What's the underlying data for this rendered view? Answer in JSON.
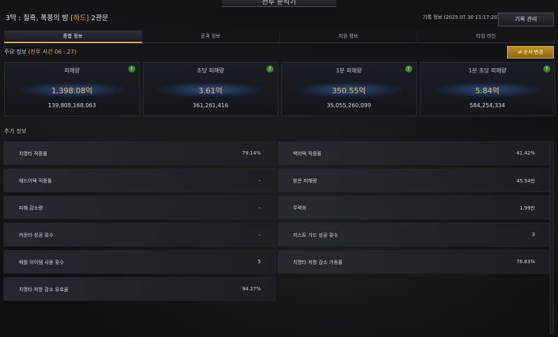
{
  "window": {
    "title": "전투 분석기"
  },
  "header": {
    "title_prefix": "3막 : 칠흑, 폭풍의 밤 ",
    "difficulty": "[하드]",
    "gate": " 2관문",
    "record_info": "기록 정보 (2025.07.30 11:17:20)",
    "record_button": "기록 관리"
  },
  "tabs": [
    "종합 정보",
    "공격 정보",
    "지원 정보",
    "타임 라인"
  ],
  "main_section": {
    "label": "주요 정보 ",
    "battle_time": "(전투 시간 06 : 27)",
    "order_button": "순서 변경"
  },
  "cards": [
    {
      "name": "피해량",
      "value": "1,398.08억",
      "sub": "139,808,168,063"
    },
    {
      "name": "초당 피해량",
      "value": "3.61억",
      "sub": "361,261,416"
    },
    {
      "name": "1분 피해량",
      "value": "350.55억",
      "sub": "35,055,260,099"
    },
    {
      "name": "1분 초당 피해량",
      "value": "5.84억",
      "sub": "584,254,334"
    }
  ],
  "help_icon": "?",
  "extra_section": {
    "label": "추가 정보"
  },
  "left_stats": [
    {
      "label": "치명타 적중률",
      "value": "79.14%"
    },
    {
      "label": "헤드어택 적중률",
      "value": "–"
    },
    {
      "label": "피해 감소량",
      "value": "–"
    },
    {
      "label": "카운터 성공 횟수",
      "value": "–"
    },
    {
      "label": "배틀 아이템 사용 횟수",
      "value": "5"
    },
    {
      "label": "치명타 저항 감소 유효율",
      "value": "94.27%"
    }
  ],
  "right_stats": [
    {
      "label": "백어택 적중률",
      "value": "41.42%"
    },
    {
      "label": "받은 피해량",
      "value": "45.54만"
    },
    {
      "label": "무력화",
      "value": "1.99만"
    },
    {
      "label": "저스트 가드 성공 횟수",
      "value": "3"
    },
    {
      "label": "치명타 저항 감소 가동률",
      "value": "76.83%"
    }
  ],
  "colors": {
    "accent": "#e5b445",
    "value_gold": "#efc04d",
    "help_green": "#3c8a2f"
  }
}
